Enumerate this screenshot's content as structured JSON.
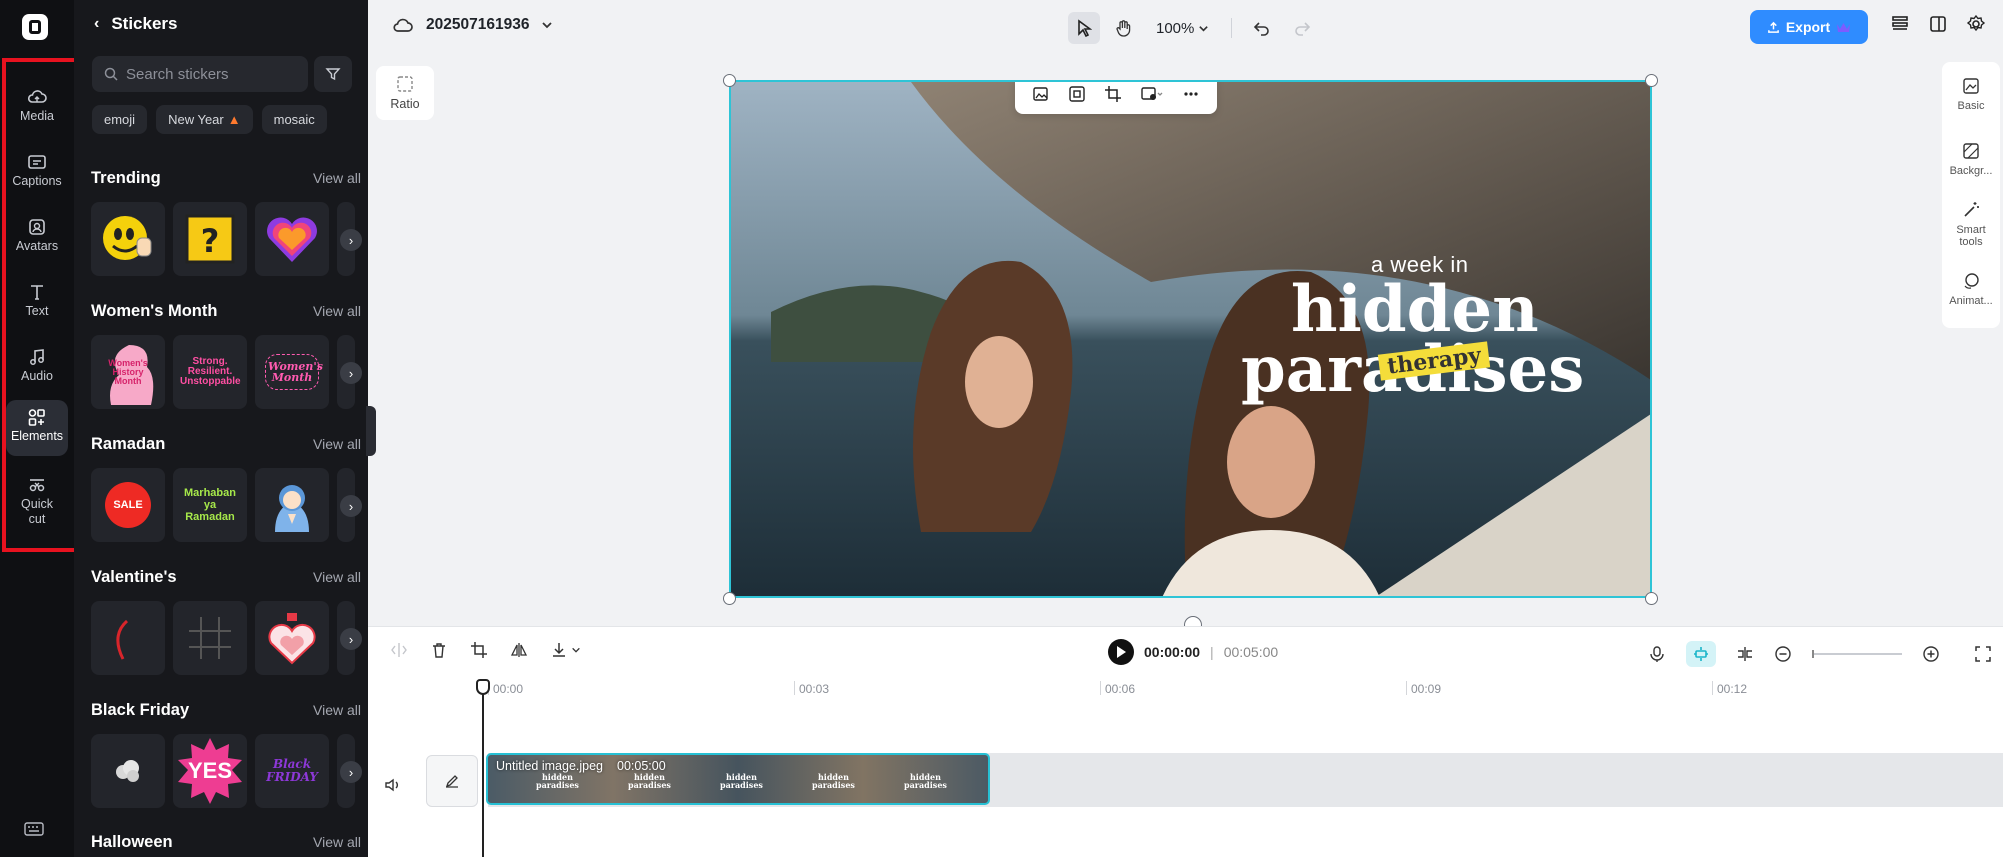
{
  "rail": {
    "items": [
      {
        "label": "Media",
        "icon": "cloud-media-icon"
      },
      {
        "label": "Captions",
        "icon": "captions-icon"
      },
      {
        "label": "Avatars",
        "icon": "avatar-icon"
      },
      {
        "label": "Text",
        "icon": "text-icon"
      },
      {
        "label": "Audio",
        "icon": "audio-note-icon"
      },
      {
        "label": "Elements",
        "icon": "elements-icon",
        "active": true
      },
      {
        "label": "Quick",
        "label2": "cut",
        "icon": "quick-cut-icon"
      }
    ],
    "highlight_color": "#e8121f"
  },
  "panel": {
    "title": "Stickers",
    "search_placeholder": "Search stickers",
    "chips": [
      "emoji",
      "New Year",
      "mosaic"
    ],
    "view_all": "View all",
    "sections": [
      {
        "title": "Trending"
      },
      {
        "title": "Women's Month",
        "sticker_texts": [
          "Women's History Month",
          "Strong. Resilient. Unstoppable",
          "Women's Month"
        ]
      },
      {
        "title": "Ramadan",
        "sticker_texts": [
          "SALE",
          "Marhaban ya Ramadan"
        ]
      },
      {
        "title": "Valentine's"
      },
      {
        "title": "Black Friday",
        "sticker_texts": [
          "YES",
          "Black FRIDAY"
        ]
      },
      {
        "title": "Halloween"
      }
    ]
  },
  "topbar": {
    "project_name": "202507161936",
    "zoom": "100%",
    "export_label": "Export",
    "accent": "#2f8cff"
  },
  "canvas": {
    "ratio_label": "Ratio",
    "overlay_line1": "a week in",
    "overlay_line2": "hidden",
    "overlay_line3": "paradises",
    "overlay_tag": "therapy",
    "selection_color": "#2ec4d6"
  },
  "right_panel": {
    "items": [
      {
        "label": "Basic",
        "icon": "basic-icon"
      },
      {
        "label": "Backgr...",
        "icon": "background-icon"
      },
      {
        "label": "Smart",
        "label2": "tools",
        "icon": "magic-wand-icon"
      },
      {
        "label": "Animat...",
        "icon": "animation-icon"
      }
    ]
  },
  "timeline": {
    "current_time": "00:00:00",
    "separator": "|",
    "total_time": "00:05:00",
    "ruler": [
      "00:00",
      "00:03",
      "00:06",
      "00:09",
      "00:12"
    ],
    "clip_name": "Untitled image.jpeg",
    "clip_duration": "00:05:00",
    "thumb_line1": "hidden",
    "thumb_line2": "paradises"
  }
}
